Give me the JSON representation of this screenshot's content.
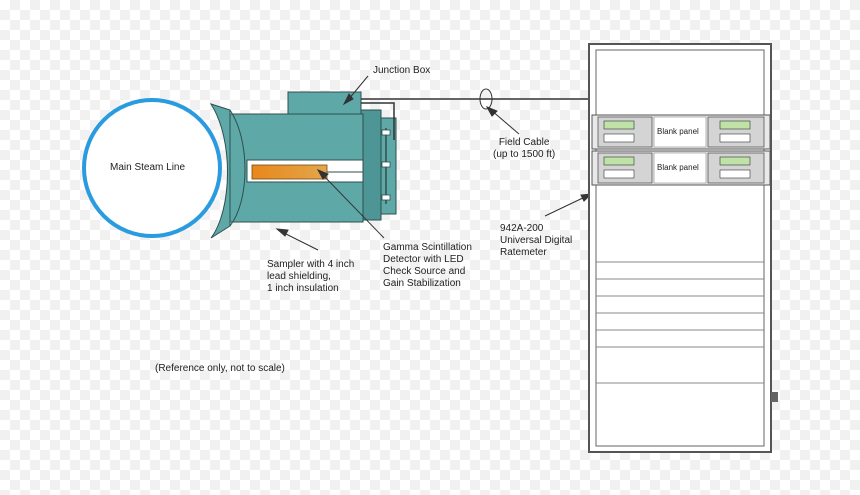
{
  "labels": {
    "main_steam_line": "Main Steam Line",
    "junction_box": "Junction Box",
    "field_cable": "Field Cable\n(up to 1500 ft)",
    "sampler": "Sampler with 4 inch\nlead shielding,\n1 inch insulation",
    "detector": "Gamma Scintillation\nDetector with LED\nCheck Source and\nGain Stabilization",
    "ratemeter": "942A-200\nUniversal Digital\nRatemeter",
    "note": "(Reference only, not to scale)"
  },
  "rack": {
    "row1_blank_panel": "Blank panel",
    "row2_blank_panel": "Blank panel"
  },
  "colors": {
    "pipe_ring": "#2b9be0",
    "sampler_body": "#5ea9a8",
    "sampler_dark": "#3f8685",
    "detector_orange": "#e8871c",
    "line": "#333333"
  }
}
